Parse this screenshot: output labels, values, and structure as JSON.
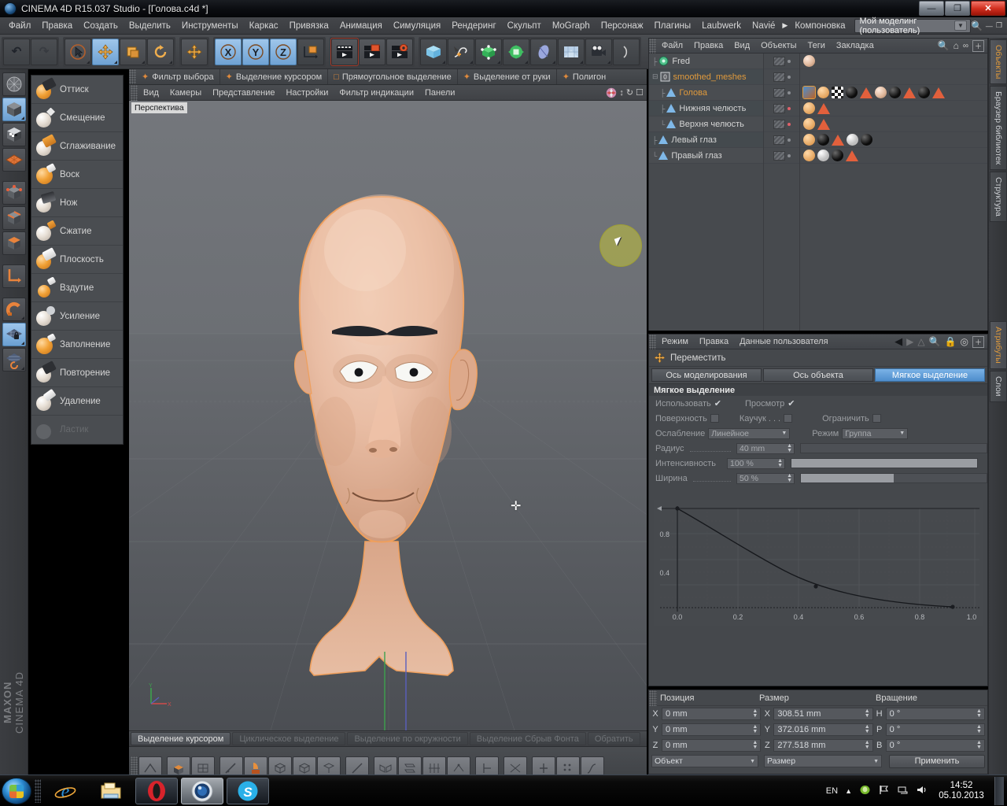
{
  "window": {
    "title": "CINEMA 4D R15.037 Studio - [Голова.c4d *]",
    "minimize": "—",
    "restore": "❐",
    "close": "✕"
  },
  "menubar": {
    "items": [
      "Файл",
      "Правка",
      "Создать",
      "Выделить",
      "Инструменты",
      "Каркас",
      "Привязка",
      "Анимация",
      "Симуляция",
      "Рендеринг",
      "Скульпт",
      "MoGraph",
      "Персонаж",
      "Плагины",
      "Laubwerk",
      "Navié",
      "Компоновка"
    ],
    "layout_value": "Мой моделинг (пользователь)",
    "layout_arrow": "▼",
    "search_icon": "search-icon"
  },
  "toolbar": {
    "undo": "↶",
    "redo": "↷",
    "select": "select-arrow-icon",
    "move": "✛",
    "scale": "scale-icon",
    "rotate": "↺",
    "move2": "✛",
    "axis_x": "X",
    "axis_y": "Y",
    "axis_z": "Z",
    "coord_system": "world-coordinate-icon",
    "render_view": "▶",
    "render_picture": "▶",
    "render_settings": "▶",
    "cube": "cube-icon",
    "spline": "spline-icon",
    "nurbs": "nurbs-icon",
    "array": "array-icon",
    "deformer": "deformer-icon",
    "env": "environment-icon",
    "camera": "camera-icon"
  },
  "sculpt_tools": {
    "items": [
      {
        "label": "Оттиск",
        "icon": "stamp-brush-icon",
        "disabled": false
      },
      {
        "label": "Смещение",
        "icon": "pull-brush-icon",
        "disabled": false
      },
      {
        "label": "Сглаживание",
        "icon": "smooth-brush-icon",
        "disabled": false
      },
      {
        "label": "Воск",
        "icon": "wax-brush-icon",
        "disabled": false
      },
      {
        "label": "Нож",
        "icon": "knife-brush-icon",
        "disabled": false
      },
      {
        "label": "Сжатие",
        "icon": "pinch-brush-icon",
        "disabled": false
      },
      {
        "label": "Плоскость",
        "icon": "flatten-brush-icon",
        "disabled": false
      },
      {
        "label": "Вздутие",
        "icon": "inflate-brush-icon",
        "disabled": false
      },
      {
        "label": "Усиление",
        "icon": "amplify-brush-icon",
        "disabled": false
      },
      {
        "label": "Заполнение",
        "icon": "fill-brush-icon",
        "disabled": false
      },
      {
        "label": "Повторение",
        "icon": "repeat-brush-icon",
        "disabled": false
      },
      {
        "label": "Удаление",
        "icon": "erase-brush-icon",
        "disabled": false
      },
      {
        "label": "Ластик",
        "icon": "eraser-icon",
        "disabled": true
      }
    ]
  },
  "left_rail": {
    "buttons": [
      {
        "name": "make-editable-icon",
        "selected": false
      },
      {
        "name": "model-mode-icon",
        "selected": true
      },
      {
        "name": "texture-mode-icon",
        "selected": false
      },
      {
        "name": "workplane-icon",
        "selected": false
      },
      {
        "name": "points-mode-icon",
        "selected": false
      },
      {
        "name": "edges-mode-icon",
        "selected": false
      },
      {
        "name": "polygons-mode-icon",
        "selected": false
      },
      {
        "name": "axis-mode-icon",
        "selected": false
      },
      {
        "name": "magnet-icon",
        "selected": false
      },
      {
        "name": "workplane-lock-icon",
        "selected": true
      },
      {
        "name": "workplane-reset-icon",
        "selected": false
      }
    ],
    "brand_line1": "MAXON",
    "brand_line2": "CINEMA 4D"
  },
  "viewport": {
    "selection_filter": [
      {
        "label": "Фильтр выбора",
        "icon": "filter-icon"
      },
      {
        "label": "Выделение курсором",
        "icon": "live-select-icon"
      },
      {
        "label": "Прямоугольное выделение",
        "icon": "rect-select-icon"
      },
      {
        "label": "Выделение от руки",
        "icon": "freehand-select-icon"
      },
      {
        "label": "Полигон",
        "icon": "polygon-select-icon"
      }
    ],
    "view_menu": [
      "Вид",
      "Камеры",
      "Представление",
      "Настройки",
      "Фильтр индикации",
      "Панели"
    ],
    "view_menu_icons": [
      "color-wheel-icon",
      "move-view-icon",
      "rotate-view-icon",
      "maximize-view-icon"
    ],
    "label": "Перспектива",
    "cursor": "mouse-cursor",
    "brush_circle": "soft-selection-radius-circle",
    "axis_gizmo": {
      "y": "Y",
      "x": "X"
    }
  },
  "viewport_tabs": [
    {
      "label": "Выделение курсором",
      "active": true
    },
    {
      "label": "Циклическое выделение",
      "active": false
    },
    {
      "label": "Выделение по окружности",
      "active": false
    },
    {
      "label": "Выделение Сбрыв Фонта",
      "active": false
    },
    {
      "label": "Обратить",
      "active": false
    }
  ],
  "object_manager": {
    "menu": [
      "Файл",
      "Правка",
      "Вид",
      "Объекты",
      "Теги",
      "Закладка"
    ],
    "menu_icons": [
      "search-icon",
      "home-icon",
      "link-icon",
      "add-icon"
    ],
    "rows": [
      {
        "name": "Fred",
        "type": "null-object",
        "indent": 0,
        "selected": false,
        "tags": [
          "material-sphere"
        ]
      },
      {
        "name": "smoothed_meshes",
        "type": "layer-object",
        "indent": 0,
        "selected": true,
        "tags": []
      },
      {
        "name": "Голова",
        "type": "polygon-object",
        "indent": 1,
        "selected": true,
        "tags": [
          "texture",
          "sculpt",
          "checker",
          "black",
          "tri",
          "skin",
          "black2",
          "tri2",
          "black3",
          "tri3"
        ]
      },
      {
        "name": "Нижняя челюсть",
        "type": "polygon-object",
        "indent": 1,
        "selected": false,
        "tags": [
          "sculpt",
          "tri"
        ]
      },
      {
        "name": "Верхня челюсть",
        "type": "polygon-object",
        "indent": 1,
        "selected": false,
        "tags": [
          "sculpt",
          "tri"
        ]
      },
      {
        "name": "Левый глаз",
        "type": "polygon-object",
        "indent": 0,
        "selected": false,
        "tags": [
          "sculpt",
          "black",
          "tri",
          "white",
          "black2"
        ]
      },
      {
        "name": "Правый глаз",
        "type": "polygon-object",
        "indent": 0,
        "selected": false,
        "tags": [
          "sculpt",
          "white",
          "black",
          "tri"
        ]
      }
    ]
  },
  "attributes": {
    "menu": [
      "Режим",
      "Правка",
      "Данные пользователя"
    ],
    "menu_icons": [
      "back-arrow-icon",
      "pin-icon",
      "search-icon",
      "lock-icon",
      "target-icon",
      "add-icon"
    ],
    "tool_title": "Переместить",
    "tool_icon": "move-tool-icon",
    "tabs": [
      {
        "label": "Ось моделирования",
        "active": false
      },
      {
        "label": "Ось объекта",
        "active": false
      },
      {
        "label": "Мягкое выделение",
        "active": true
      }
    ],
    "section_title": "Мягкое выделение",
    "fields": {
      "use_label": "Использовать",
      "use_checked": "✔",
      "preview_label": "Просмотр",
      "preview_checked": "✔",
      "surface_label": "Поверхность",
      "rubber_label": "Каучук . . .",
      "limit_label": "Ограничить",
      "falloff_label": "Ослабление",
      "falloff_value": "Линейное",
      "mode_label": "Режим",
      "mode_value": "Группа",
      "radius_label": "Радиус",
      "radius_value": "40 mm",
      "strength_label": "Интенсивность",
      "strength_value": "100 %",
      "strength_pct": 100,
      "width_label": "Ширина",
      "width_value": "50 %",
      "width_pct": 50
    }
  },
  "chart_data": {
    "type": "line",
    "title": "",
    "xlabel": "",
    "ylabel": "",
    "xlim": [
      0.0,
      1.0
    ],
    "ylim": [
      0.0,
      1.0
    ],
    "xticks": [
      "0.0",
      "0.2",
      "0.4",
      "0.6",
      "0.8",
      "1.0"
    ],
    "yticks": [
      "0.4",
      "0.8"
    ],
    "grid": true,
    "legend": "none",
    "series": [
      {
        "name": "Falloff curve",
        "x": [
          0.0,
          0.1,
          0.2,
          0.3,
          0.4,
          0.5,
          0.6,
          0.7,
          0.8,
          0.9,
          1.0
        ],
        "y": [
          1.0,
          0.88,
          0.76,
          0.64,
          0.5,
          0.38,
          0.27,
          0.18,
          0.11,
          0.05,
          0.0
        ]
      }
    ],
    "knots": [
      [
        0.0,
        1.0
      ],
      [
        0.5,
        0.38
      ],
      [
        1.0,
        0.0
      ]
    ]
  },
  "coordinates": {
    "headers": [
      "Позиция",
      "Размер",
      "Вращение"
    ],
    "position": [
      {
        "axis": "X",
        "value": "0 mm"
      },
      {
        "axis": "Y",
        "value": "0 mm"
      },
      {
        "axis": "Z",
        "value": "0 mm"
      }
    ],
    "size": [
      {
        "axis": "X",
        "value": "308.51 mm"
      },
      {
        "axis": "Y",
        "value": "372.016 mm"
      },
      {
        "axis": "Z",
        "value": "277.518 mm"
      }
    ],
    "rotation": [
      {
        "axis": "H",
        "value": "0 °"
      },
      {
        "axis": "P",
        "value": "0 °"
      },
      {
        "axis": "B",
        "value": "0 °"
      }
    ],
    "dropdown_left": "Объект",
    "dropdown_mid": "Размер",
    "apply_button": "Применить"
  },
  "vertical_tabs": [
    {
      "label": "Объекты",
      "active": true
    },
    {
      "label": "Браузер библиотек",
      "active": false
    },
    {
      "label": "Структура",
      "active": false
    },
    {
      "label": "Атрибуты",
      "active": true
    },
    {
      "label": "Слои",
      "active": false
    }
  ],
  "taskbar": {
    "start": "windows-start-orb",
    "items": [
      {
        "name": "internet-explorer-icon",
        "pinned": true
      },
      {
        "name": "file-explorer-icon",
        "pinned": true
      },
      {
        "name": "opera-icon",
        "running": true
      },
      {
        "name": "cinema4d-icon",
        "running": true,
        "active": true
      },
      {
        "name": "skype-icon",
        "running": true
      }
    ],
    "tray_language": "EN",
    "tray_icons": [
      "show-hidden-icons",
      "nvidia-icon",
      "flag-icon",
      "network-icon",
      "volume-icon"
    ],
    "time": "14:52",
    "date": "05.10.2013"
  },
  "colors": {
    "accent_orange": "#e09a3c",
    "accent_blue": "#6fa2d4",
    "panel": "#45484c",
    "selection_outline": "#f0a05a",
    "skin": "#e8b79c"
  }
}
